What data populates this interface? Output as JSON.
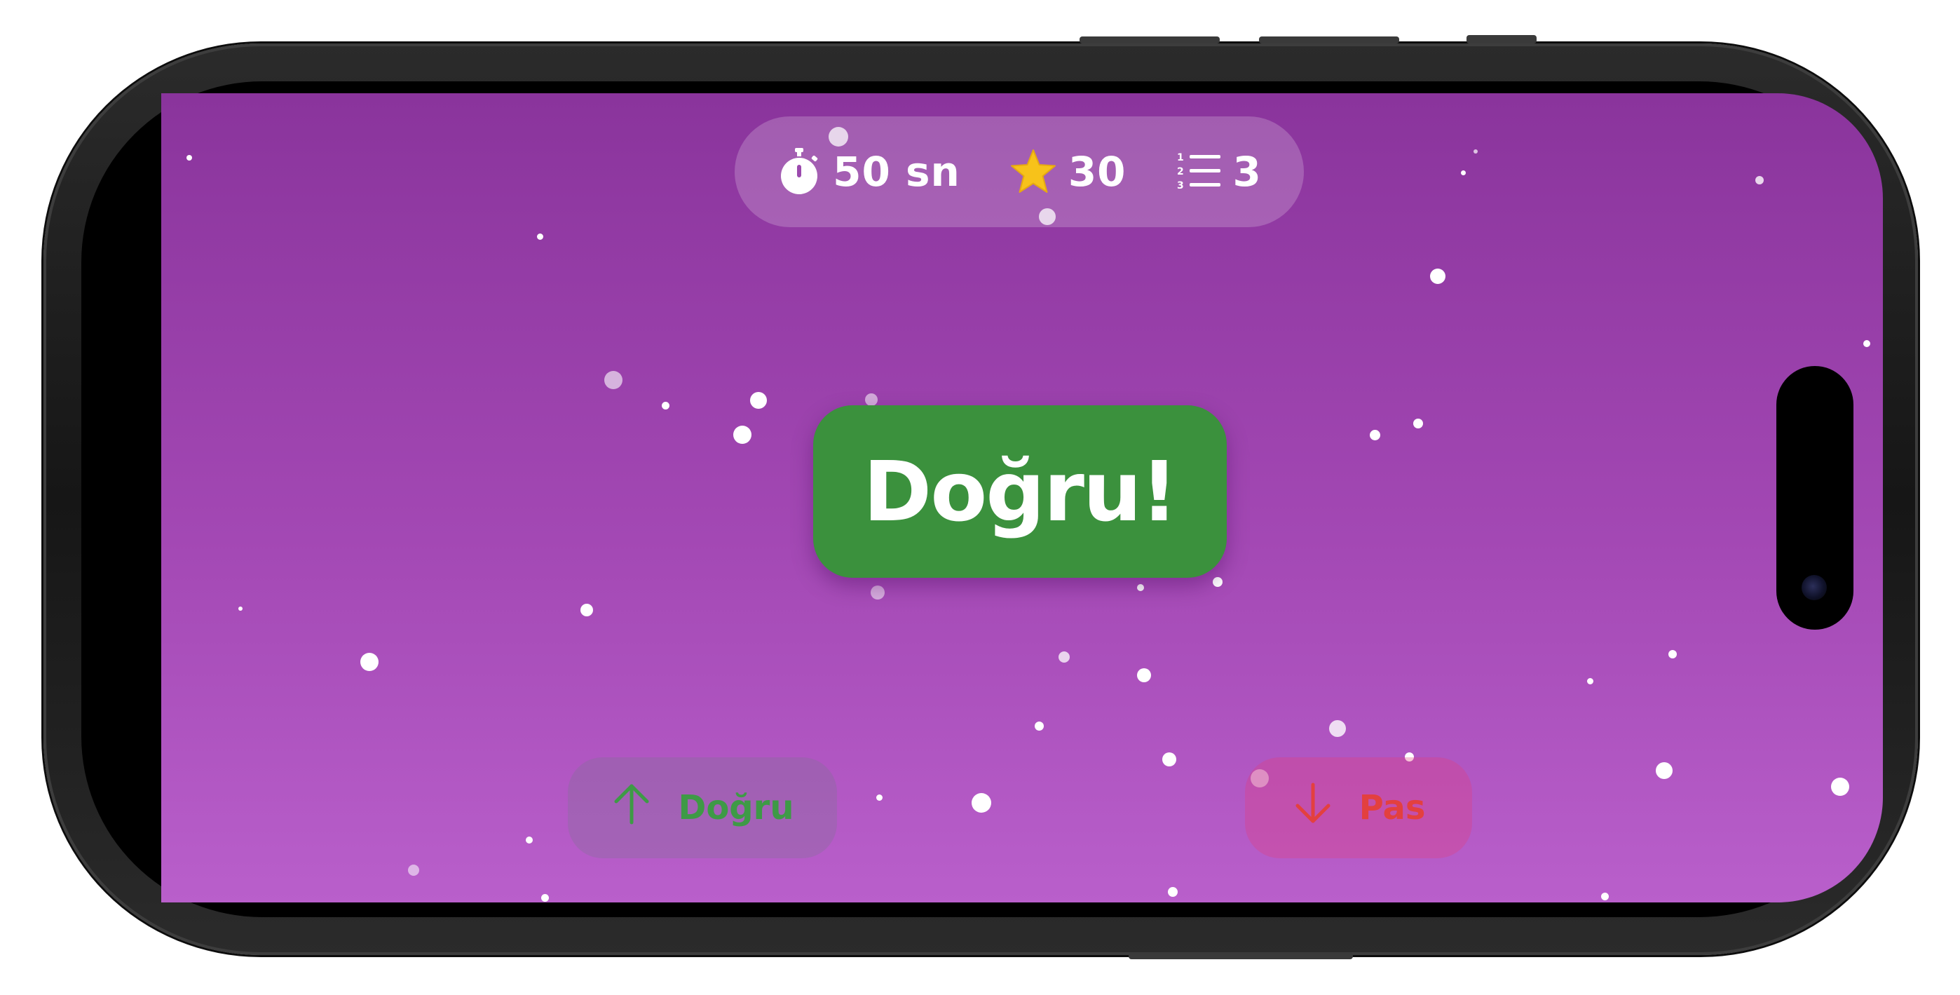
{
  "hud": {
    "timer": "50 sn",
    "timer_icon": "stopwatch-icon",
    "score": "30",
    "score_icon": "star-icon",
    "round": "3",
    "round_icon": "numbered-list-icon"
  },
  "result": {
    "text": "Doğru!",
    "color": "#3b913d"
  },
  "actions": {
    "correct_label": "Doğru",
    "correct_icon": "arrow-up-icon",
    "correct_color": "#3e9a46",
    "pass_label": "Pas",
    "pass_icon": "arrow-down-icon",
    "pass_color": "#e3403f"
  },
  "colors": {
    "background_top": "#8a349c",
    "background_bottom": "#b95fcb",
    "star": "#f7c21a"
  }
}
